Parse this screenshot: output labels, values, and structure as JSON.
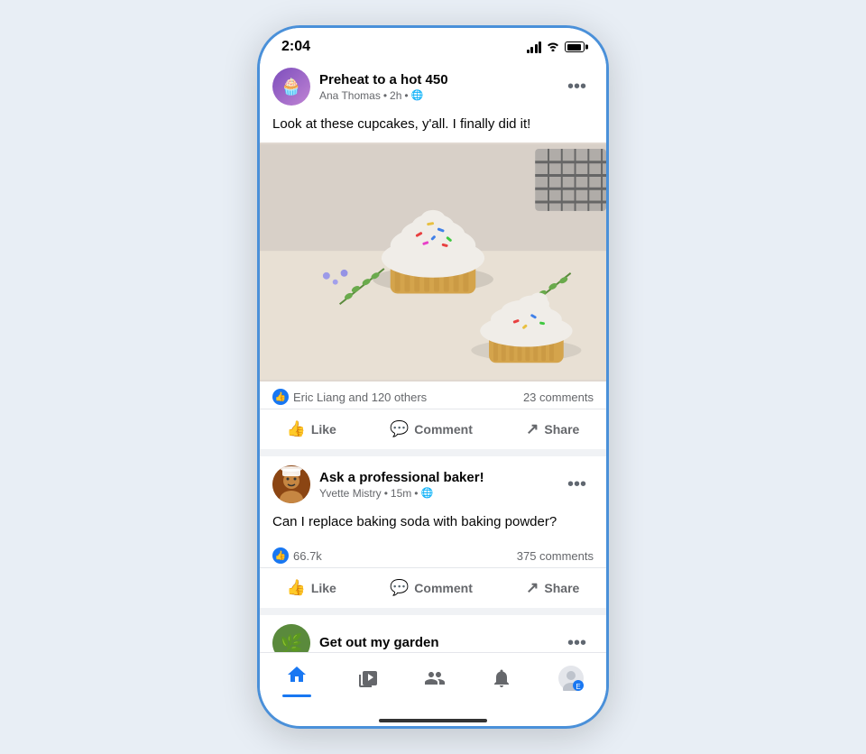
{
  "statusBar": {
    "time": "2:04",
    "signal": "full",
    "wifi": true,
    "battery": "full"
  },
  "posts": [
    {
      "id": "post1",
      "groupName": "Preheat to a hot 450",
      "author": "Ana Thomas",
      "time": "2h",
      "privacy": "globe",
      "postText": "Look at these cupcakes, y'all. I finally did it!",
      "hasImage": true,
      "reactions": {
        "likeText": "Eric Liang and 120 others",
        "commentCount": "23 comments"
      }
    },
    {
      "id": "post2",
      "groupName": "Ask a professional baker!",
      "author": "Yvette Mistry",
      "time": "15m",
      "privacy": "globe",
      "postText": "Can I replace baking soda with baking powder?",
      "hasImage": false,
      "reactions": {
        "likeText": "66.7k",
        "commentCount": "375 comments"
      }
    },
    {
      "id": "post3",
      "groupName": "Get out my garden",
      "author": "",
      "time": "",
      "privacy": "",
      "postText": "",
      "hasImage": false,
      "reactions": null
    }
  ],
  "actions": {
    "like": "Like",
    "comment": "Comment",
    "share": "Share"
  },
  "bottomNav": {
    "home": "home",
    "video": "video",
    "groups": "groups",
    "notifications": "notifications",
    "profile": "profile"
  },
  "moreButtonLabel": "•••"
}
